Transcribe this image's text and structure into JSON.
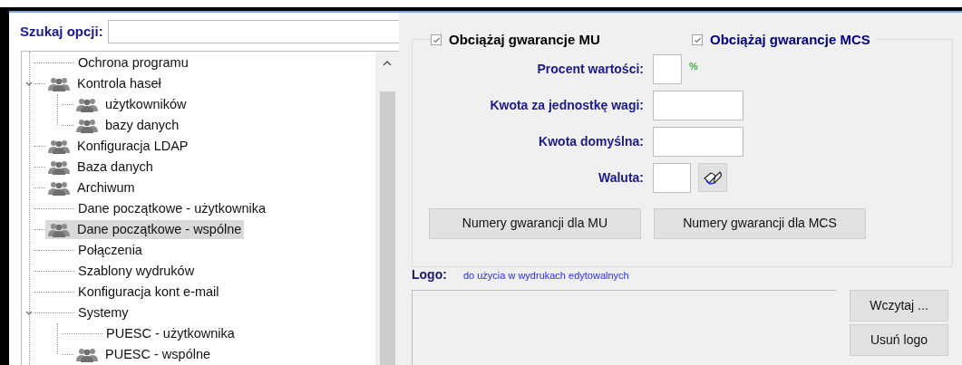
{
  "search": {
    "label": "Szukaj opcji:"
  },
  "tree": [
    {
      "label": "Ochrona programu",
      "icon": false,
      "selected": false
    },
    {
      "label": "Kontrola haseł",
      "icon": true,
      "selected": false,
      "expanded": true,
      "children": [
        {
          "label": "użytkowników",
          "icon": true,
          "selected": false
        },
        {
          "label": "bazy danych",
          "icon": true,
          "selected": false
        }
      ]
    },
    {
      "label": "Konfiguracja LDAP",
      "icon": true,
      "selected": false
    },
    {
      "label": "Baza danych",
      "icon": true,
      "selected": false
    },
    {
      "label": "Archiwum",
      "icon": true,
      "selected": false
    },
    {
      "label": "Dane początkowe - użytkownika",
      "icon": false,
      "selected": false
    },
    {
      "label": "Dane początkowe - wspólne",
      "icon": true,
      "selected": true
    },
    {
      "label": "Połączenia",
      "icon": false,
      "selected": false
    },
    {
      "label": "Szablony wydruków",
      "icon": false,
      "selected": false
    },
    {
      "label": "Konfiguracja kont e-mail",
      "icon": false,
      "selected": false
    },
    {
      "label": "Systemy",
      "icon": false,
      "selected": false,
      "expanded": true,
      "children": [
        {
          "label": "PUESC - użytkownika",
          "icon": false,
          "selected": false
        },
        {
          "label": "PUESC - wspólne",
          "icon": true,
          "selected": false
        }
      ]
    }
  ],
  "guarantee": {
    "checkboxes": [
      {
        "label": "Obciążaj gwarancje MU",
        "checked": true,
        "color": "#000000"
      },
      {
        "label": "Obciążaj gwarancje MCS",
        "checked": true,
        "color": "#000080"
      }
    ],
    "fields": [
      {
        "kind": "percent",
        "label": "Procent wartości:",
        "unit": "%"
      },
      {
        "kind": "amount",
        "label": "Kwota za jednostkę wagi:"
      },
      {
        "kind": "amount",
        "label": "Kwota domyślna:"
      },
      {
        "kind": "lookup",
        "label": "Waluta:"
      }
    ],
    "buttons": [
      "Numery gwarancji dla MU",
      "Numery gwarancji dla MCS"
    ]
  },
  "logo": {
    "label": "Logo:",
    "hint": "do użycia w wydrukach edytowalnych",
    "buttons": [
      "Wczytaj ...",
      "Usuń logo"
    ]
  }
}
